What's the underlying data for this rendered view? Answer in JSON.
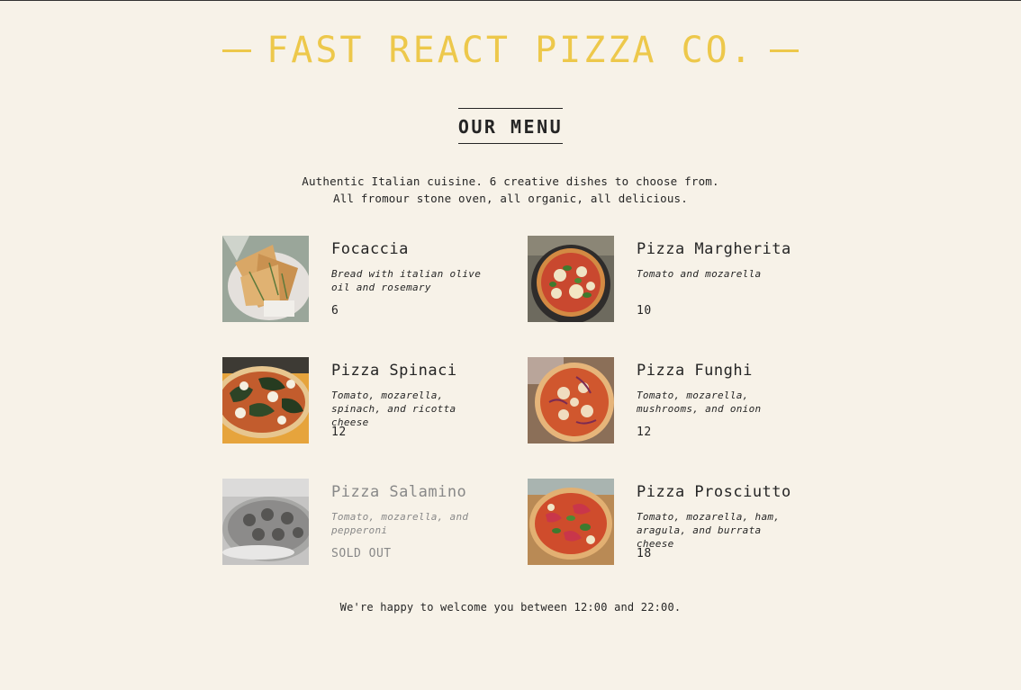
{
  "header": {
    "title": "Fast React Pizza Co."
  },
  "menu": {
    "title": "Our Menu",
    "intro": "Authentic Italian cuisine. 6 creative dishes to choose from. All fromour stone oven, all organic, all delicious."
  },
  "pizzas": [
    {
      "name": "Focaccia",
      "ingredients": "Bread with italian olive oil and rosemary",
      "price": "6",
      "photo": "focaccia-photo"
    },
    {
      "name": "Pizza Margherita",
      "ingredients": "Tomato and mozarella",
      "price": "10",
      "photo": "pizza-margherita-photo"
    },
    {
      "name": "Pizza Spinaci",
      "ingredients": "Tomato, mozarella, spinach, and ricotta cheese",
      "price": "12",
      "photo": "pizza-spinaci-photo"
    },
    {
      "name": "Pizza Funghi",
      "ingredients": "Tomato, mozarella, mushrooms, and onion",
      "price": "12",
      "photo": "pizza-funghi-photo"
    },
    {
      "name": "Pizza Salamino",
      "ingredients": "Tomato, mozarella, and pepperoni",
      "price": "SOLD OUT",
      "photo": "pizza-salamino-photo"
    },
    {
      "name": "Pizza Prosciutto",
      "ingredients": "Tomato, mozarella, ham, aragula, and burrata cheese",
      "price": "18",
      "photo": "pizza-prosciutto-photo"
    }
  ],
  "footer": {
    "text": "We're happy to welcome you between 12:00 and 22:00."
  },
  "colors": {
    "background": "#f7f2e8",
    "accent": "#edc84b",
    "text": "#252525",
    "sold_out": "#888888"
  }
}
